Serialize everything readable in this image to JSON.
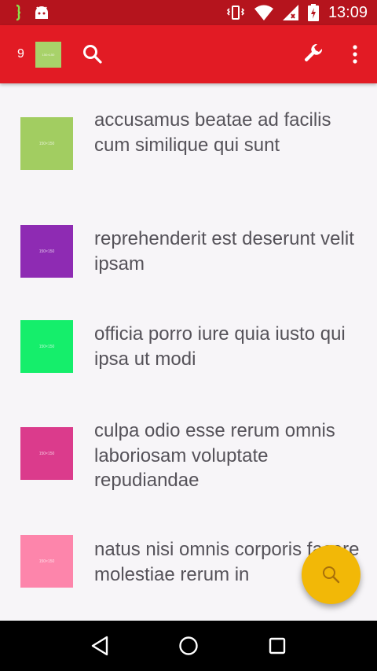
{
  "status_bar": {
    "time": "13:09"
  },
  "app_bar": {
    "count": "9",
    "thumb_color": "#a8d26a"
  },
  "items": [
    {
      "text": "accusamus beatae ad facilis cum similique qui sunt",
      "color": "#a2cd61"
    },
    {
      "text": "reprehenderit est deserunt velit ipsam",
      "color": "#8e2bb3"
    },
    {
      "text": "officia porro iure quia iusto qui ipsa ut modi",
      "color": "#15ee6b"
    },
    {
      "text": "culpa odio esse rerum omnis laboriosam voluptate repudiandae",
      "color": "#db3b8c"
    },
    {
      "text": "natus nisi omnis corporis facere molestiae rerum in",
      "color": "#fd85ab"
    }
  ],
  "colors": {
    "status_bar": "#b5141d",
    "app_bar": "#e21b24",
    "fab": "#f2b807"
  }
}
